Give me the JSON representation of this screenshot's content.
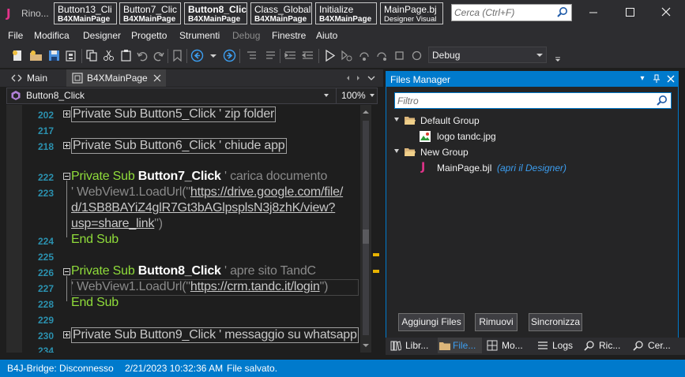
{
  "app": {
    "title": "Rino..."
  },
  "doc_tabs": [
    {
      "line1": "Button13_Cli",
      "line2": "B4XMainPage",
      "active": false
    },
    {
      "line1": "Button7_Clic",
      "line2": "B4XMainPage",
      "active": false
    },
    {
      "line1": "Button8_Clic",
      "line2": "B4XMainPage",
      "active": true
    },
    {
      "line1": "Class_Global",
      "line2": "B4XMainPage",
      "active": false
    },
    {
      "line1": "Initialize",
      "line2": "B4XMainPage",
      "active": false
    },
    {
      "line1": "MainPage.bj",
      "line2": "Designer Visual",
      "active": false
    }
  ],
  "search": {
    "placeholder": "Cerca (Ctrl+F)"
  },
  "menu": [
    "File",
    "Modifica",
    "Designer",
    "Progetto",
    "Strumenti",
    "Debug",
    "Finestre",
    "Aiuto"
  ],
  "toolbar": {
    "config": "Debug"
  },
  "editor": {
    "tabs": [
      "Main",
      "B4XMainPage"
    ],
    "sub_selector": "Button8_Click",
    "zoom": "100%",
    "line_numbers": [
      "202",
      "217",
      "218",
      "222",
      "223",
      "224",
      "225",
      "226",
      "227",
      "228",
      "229",
      "230",
      "234"
    ],
    "code": {
      "l202": "Private Sub Button5_Click ' zip folder",
      "l218": "Private Sub Button6_Click ' chiude app",
      "l222_kw": "Private Sub ",
      "l222_name": "Button7_Click",
      "l222_cm": " ' carica documento",
      "l223_a": "'    WebView1.LoadUrl(\"",
      "l223_url1": "https://drive.google.com/file/",
      "l223_url2": "d/1SB8BAYiZ4glR7Gt3bAGlpsplsN3j8zhK/view?",
      "l223_url3": "usp=share_link",
      "l223_end": "\")",
      "l224": "End Sub",
      "l226_kw": "Private Sub ",
      "l226_name": "Button8_Click",
      "l226_cm": " ' apre sito TandC",
      "l227_a": "'    WebView1.LoadUrl(\"",
      "l227_url": "https://crm.tandc.it/login",
      "l227_end": "\")",
      "l228": "End Sub",
      "l230": "Private Sub Button9_Click ' messaggio su whatsapp"
    }
  },
  "files_manager": {
    "title": "Files Manager",
    "filter_placeholder": "Filtro",
    "tree": {
      "group1": "Default Group",
      "file1": "logo tandc.jpg",
      "group2": "New Group",
      "file2": "MainPage.bjl",
      "file2_hint": "(apri il Designer)"
    },
    "buttons": [
      "Aggiungi Files",
      "Rimuovi",
      "Sincronizza"
    ],
    "tabs": [
      "Libr...",
      "File...",
      "Mo...",
      "Logs",
      "Ric...",
      "Cer..."
    ]
  },
  "status": {
    "bridge": "B4J-Bridge: Disconnesso",
    "timestamp": "2/21/2023 10:32:36 AM",
    "message": "File salvato."
  },
  "colors": {
    "accent": "#007acc",
    "keyword": "#8fdc3a",
    "comment": "#8a8a8a",
    "line_number": "#2b91af",
    "app_logo": "#e2338a"
  }
}
